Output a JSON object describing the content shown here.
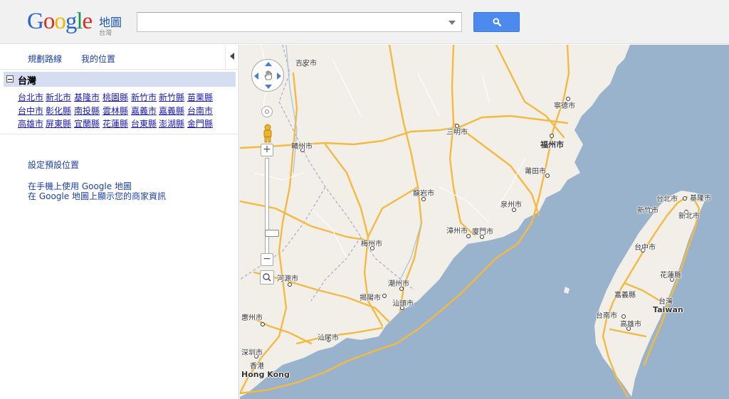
{
  "header": {
    "logo_text": "Google",
    "product_name": "地圖",
    "region_label": "台灣",
    "search": {
      "value": "",
      "placeholder": ""
    },
    "search_button_icon": "search-icon"
  },
  "panel": {
    "tabs": [
      {
        "label": "規劃路線"
      },
      {
        "label": "我的位置"
      }
    ],
    "collapse_icon": "collapse-left-icon",
    "region_title": "台灣",
    "cities": [
      "台北市",
      "新北市",
      "基隆市",
      "桃園縣",
      "新竹市",
      "新竹縣",
      "苗栗縣",
      "台中市",
      "彰化縣",
      "南投縣",
      "雲林縣",
      "嘉義市",
      "嘉義縣",
      "台南市",
      "高雄市",
      "屏東縣",
      "宜蘭縣",
      "花蓮縣",
      "台東縣",
      "澎湖縣",
      "金門縣"
    ],
    "links": {
      "default_location": "設定預設位置",
      "mobile": "在手機上使用 Google 地圖",
      "business": "在 Google 地圖上顯示您的商家資訊"
    }
  },
  "map": {
    "controls": {
      "pan": "pan-control",
      "pegman": "street-view-pegman-icon",
      "zoom_in": "+",
      "zoom_out": "−"
    },
    "colors": {
      "water": "#99b3cc",
      "land": "#f2efe9",
      "road": "#f5b942",
      "minor_road": "#ffffff",
      "border": "#b3a6c6"
    },
    "places": [
      "吉安市",
      "寧德市",
      "三明市",
      "福州市",
      "贛州市",
      "莆田市",
      "龍岩市",
      "泉州市",
      "漳州市",
      "廈門市",
      "梅州市",
      "河源市",
      "潮州市",
      "揭陽市",
      "汕頭市",
      "惠州市",
      "汕尾市",
      "深圳市",
      "香港",
      "Hong Kong",
      "台北市",
      "基隆市",
      "新竹市",
      "新北市",
      "台中市",
      "花蓮縣",
      "嘉義縣",
      "台灣",
      "Taiwan",
      "台南市",
      "高雄市"
    ]
  }
}
